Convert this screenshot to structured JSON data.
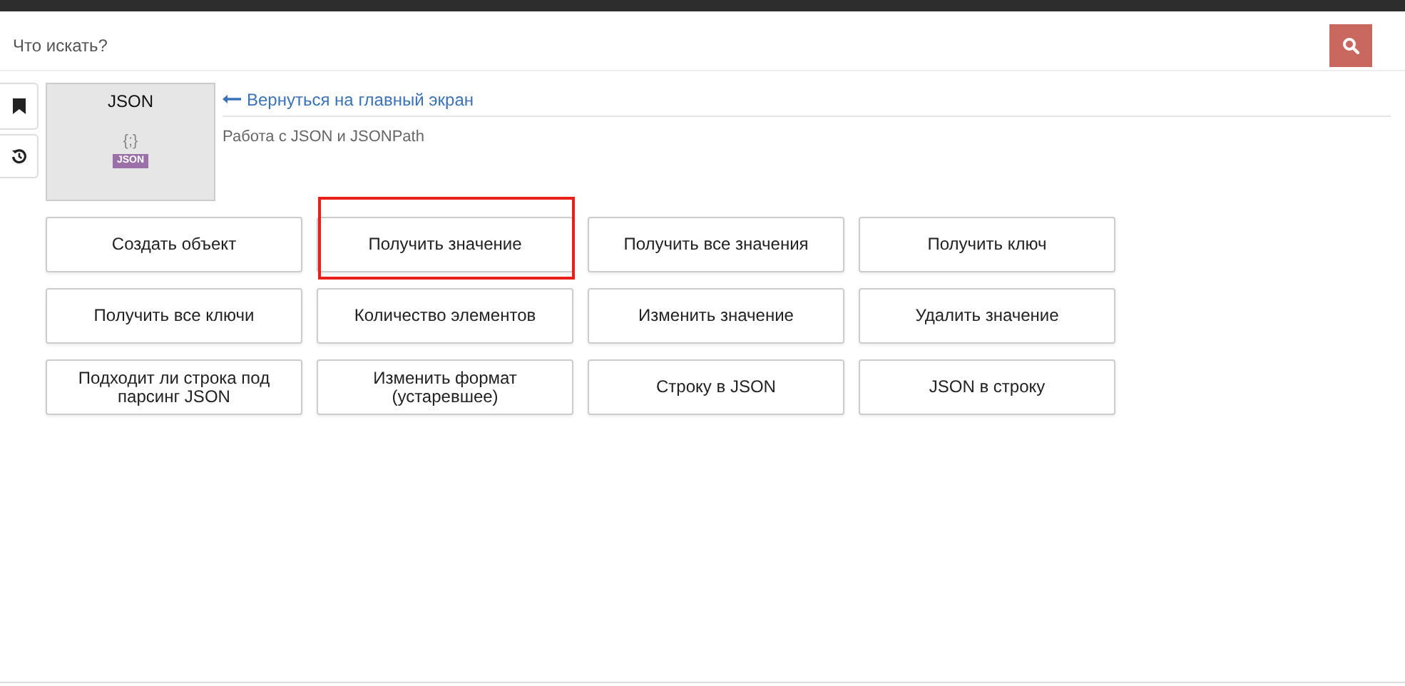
{
  "search": {
    "placeholder": "Что искать?"
  },
  "card": {
    "title": "JSON",
    "badge": "JSON",
    "glyph": "{;}"
  },
  "back_link": "Вернуться на главный экран",
  "description": "Работа с JSON и JSONPath",
  "actions": [
    {
      "label": "Создать объект",
      "highlighted": false
    },
    {
      "label": "Получить значение",
      "highlighted": true
    },
    {
      "label": "Получить все значения",
      "highlighted": false
    },
    {
      "label": "Получить ключ",
      "highlighted": false
    },
    {
      "label": "Получить все ключи",
      "highlighted": false
    },
    {
      "label": "Количество элементов",
      "highlighted": false
    },
    {
      "label": "Изменить значение",
      "highlighted": false
    },
    {
      "label": "Удалить значение",
      "highlighted": false
    },
    {
      "label": "Подходит ли строка под парсинг JSON",
      "highlighted": false
    },
    {
      "label": "Изменить формат (устаревшее)",
      "highlighted": false
    },
    {
      "label": "Строку в JSON",
      "highlighted": false
    },
    {
      "label": "JSON в строку",
      "highlighted": false
    }
  ]
}
